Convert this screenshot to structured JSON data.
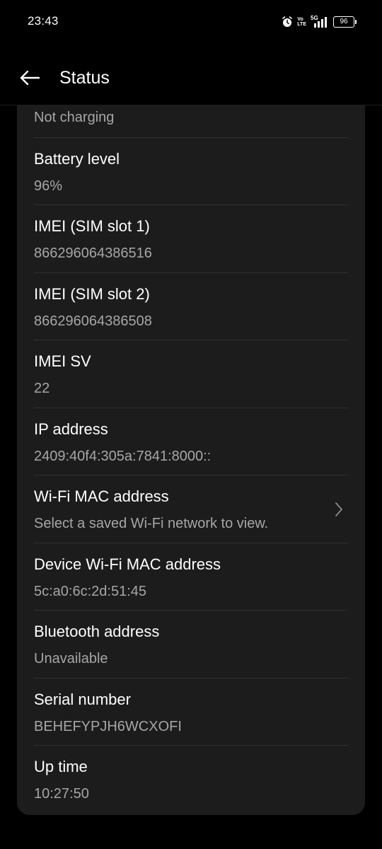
{
  "status_bar": {
    "time": "23:43",
    "volte_top": "Vo",
    "volte_bottom": "LTE",
    "network": "5G",
    "battery": "96"
  },
  "header": {
    "title": "Status"
  },
  "first_value": "Not charging",
  "items": [
    {
      "title": "Battery level",
      "value": "96%"
    },
    {
      "title": "IMEI (SIM slot 1)",
      "value": "866296064386516"
    },
    {
      "title": "IMEI (SIM slot 2)",
      "value": "866296064386508"
    },
    {
      "title": "IMEI SV",
      "value": "22"
    },
    {
      "title": "IP address",
      "value": "2409:40f4:305a:7841:8000::"
    },
    {
      "title": "Wi-Fi MAC address",
      "value": "Select a saved Wi-Fi network to view."
    },
    {
      "title": "Device Wi-Fi MAC address",
      "value": "5c:a0:6c:2d:51:45"
    },
    {
      "title": "Bluetooth address",
      "value": "Unavailable"
    },
    {
      "title": "Serial number",
      "value": "BEHEFYPJH6WCXOFI"
    },
    {
      "title": "Up time",
      "value": "10:27:50"
    }
  ],
  "icons": {
    "alarm": "alarm-clock-icon",
    "signal": "signal-bars-icon",
    "battery": "battery-icon",
    "back": "arrow-left-icon",
    "chevron": "chevron-right-icon"
  },
  "colors": {
    "background": "#000000",
    "card": "#1c1c1c",
    "title_text": "#ffffff",
    "secondary_text": "#a6a6a6",
    "divider": "#303030"
  }
}
